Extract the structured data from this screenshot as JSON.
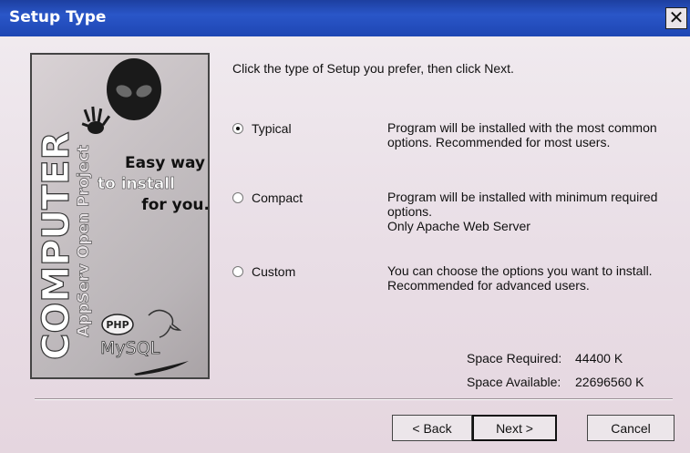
{
  "window": {
    "title": "Setup Type",
    "close_symbol": "✕"
  },
  "banner": {
    "tagline_1": "Easy way",
    "tagline_2": "to install",
    "tagline_3": "for you.",
    "brand_vertical": "COMPUTER",
    "product_vertical": "AppServ Open Project",
    "php_logo": "PHP",
    "mysql_logo": "MySQL"
  },
  "instruction": "Click the type of Setup you prefer, then click Next.",
  "options": [
    {
      "label": "Typical",
      "checked": true,
      "desc": [
        "Program will be installed with the most common",
        "options. Recommended for most users."
      ]
    },
    {
      "label": "Compact",
      "checked": false,
      "desc": [
        "Program will be installed with minimum required",
        "options.",
        "Only Apache Web Server"
      ]
    },
    {
      "label": "Custom",
      "checked": false,
      "desc": [
        "You can choose the options you want to install.",
        "Recommended for advanced users."
      ]
    }
  ],
  "space": {
    "required_label": "Space Required:",
    "required_value": "44400 K",
    "available_label": "Space Available:",
    "available_value": "22696560 K"
  },
  "buttons": {
    "back": "< Back",
    "next": "Next >",
    "cancel": "Cancel"
  }
}
